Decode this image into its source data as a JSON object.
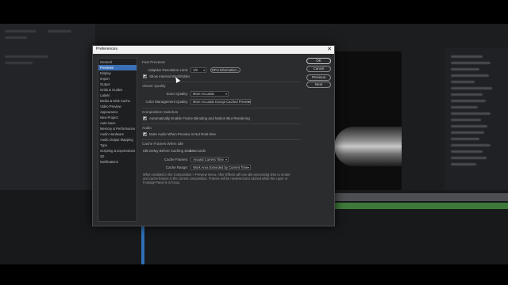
{
  "window": {
    "title": "Preferences",
    "close_glyph": "✕"
  },
  "categories": [
    {
      "label": "General",
      "selected": false
    },
    {
      "label": "Previews",
      "selected": true
    },
    {
      "label": "Display",
      "selected": false
    },
    {
      "label": "Import",
      "selected": false
    },
    {
      "label": "Output",
      "selected": false
    },
    {
      "label": "Grids & Guides",
      "selected": false
    },
    {
      "label": "Labels",
      "selected": false
    },
    {
      "label": "Media & Disk Cache",
      "selected": false
    },
    {
      "label": "Video Preview",
      "selected": false
    },
    {
      "label": "Appearance",
      "selected": false
    },
    {
      "label": "New Project",
      "selected": false
    },
    {
      "label": "Auto-Save",
      "selected": false
    },
    {
      "label": "Memory & Performance",
      "selected": false
    },
    {
      "label": "Audio Hardware",
      "selected": false
    },
    {
      "label": "Audio Output Mapping",
      "selected": false
    },
    {
      "label": "Type",
      "selected": false
    },
    {
      "label": "Scripting & Expressions",
      "selected": false
    },
    {
      "label": "3D",
      "selected": false
    },
    {
      "label": "Notifications",
      "selected": false
    }
  ],
  "fast_previews": {
    "heading": "Fast Previews",
    "adaptive_label": "Adaptive Resolution Limit:",
    "adaptive_value": "1/8",
    "gpu_button": "GPU Information...",
    "show_warning_label": "Show Internal Watchfolder",
    "show_warning_checked": true
  },
  "viewer_quality": {
    "heading": "Viewer Quality",
    "zoom_label": "Zoom Quality:",
    "zoom_value": "More Accurate",
    "color_label": "Color Management Quality:",
    "color_value": "More Accurate Except Cached Preview"
  },
  "composition_switches": {
    "heading": "Composition Switches",
    "auto_label": "Automatically Enable Frame Blending and Motion Blur Rendering",
    "auto_checked": true
  },
  "audio": {
    "heading": "Audio",
    "mute_label": "Mute Audio When Preview is Not Real-time",
    "mute_checked": true
  },
  "cache": {
    "heading": "Cache Frames When Idle",
    "delay_label": "Idle Delay Before Caching Starts:",
    "delay_value": "5 seconds",
    "frames_label": "Cache Frames:",
    "frames_value": "Around Current Time",
    "range_label": "Cache Range:",
    "range_value": "Work Area Extended by Current Time",
    "note": "When enabled in the Composition > Preview menu, After Effects will use idle processing time to render and cache frames in the current composition. Frames will be rendered and cached while the Layer or Footage Panel is in focus."
  },
  "buttons": {
    "ok": "OK",
    "cancel": "Cancel",
    "previous": "Previous",
    "next": "Next"
  },
  "colors": {
    "selection": "#3b6fb6",
    "dialog_bg": "#2b2c2e",
    "titlebar": "#f1f1f1"
  }
}
